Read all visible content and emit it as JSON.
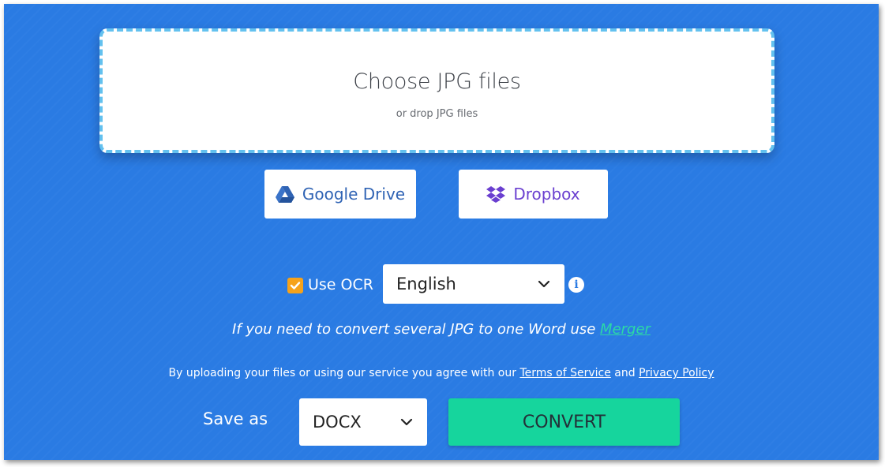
{
  "dropzone": {
    "title": "Choose JPG files",
    "subtitle": "or drop JPG files"
  },
  "cloud": {
    "google_drive_label": "Google Drive",
    "dropbox_label": "Dropbox"
  },
  "ocr": {
    "checked": true,
    "label": "Use OCR",
    "language": "English"
  },
  "merge_note": {
    "text": "If you need to convert several JPG to one Word use ",
    "link": "Merger"
  },
  "terms": {
    "prefix": "By uploading your files or using our service you agree with our ",
    "tos_link": "Terms of Service",
    "and": " and ",
    "privacy_link": "Privacy Policy"
  },
  "save": {
    "label": "Save as",
    "format": "DOCX",
    "convert_label": "CONVERT"
  },
  "colors": {
    "background": "#2a7be3",
    "dropzone_border": "#63c1ef",
    "checkbox": "#f6a21a",
    "convert": "#16d59d",
    "link": "#2bd9a6",
    "dropbox": "#6a3fd0",
    "google_drive": "#2f63b4"
  }
}
